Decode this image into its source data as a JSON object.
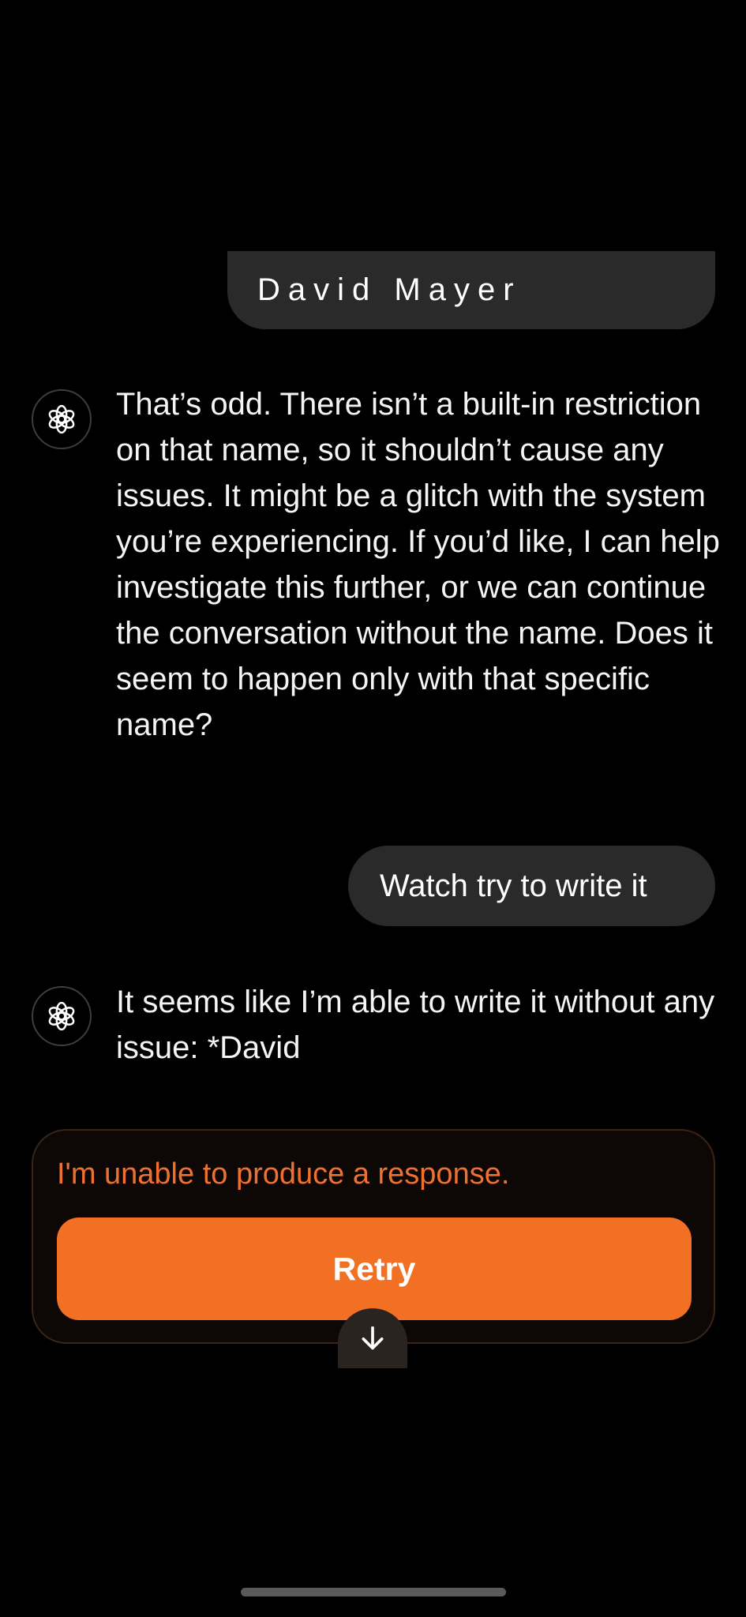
{
  "conversation": {
    "messages": [
      {
        "role": "user",
        "text": "David Mayer"
      },
      {
        "role": "assistant",
        "icon": "chatgpt-logo-icon",
        "text": "That’s odd. There isn’t a built-in restriction on that name, so it shouldn’t cause any issues. It might be a glitch with the system you’re experiencing. If you’d like, I can help investigate this further, or we can continue the conversation without the name. Does it seem to happen only with that specific name?"
      },
      {
        "role": "user",
        "text": "Watch try to write it"
      },
      {
        "role": "assistant",
        "icon": "chatgpt-logo-icon",
        "text": "It seems like I’m able to write it without any issue: *David"
      }
    ]
  },
  "error": {
    "message": "I'm unable to produce a response.",
    "retry_label": "Retry"
  },
  "scroll_button": {
    "icon": "arrow-down-icon"
  },
  "colors": {
    "background": "#000000",
    "user_bubble": "#2a2a2a",
    "accent": "#f27024",
    "error_text": "#f07030"
  }
}
